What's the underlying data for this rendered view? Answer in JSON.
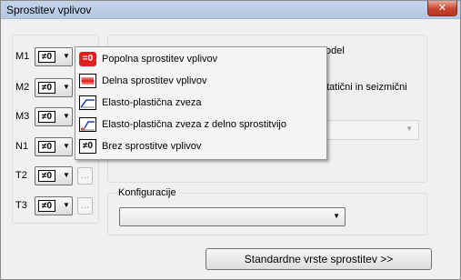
{
  "window": {
    "title": "Sprostitev vplivov",
    "close_label": "✕"
  },
  "rows": [
    {
      "label": "M1",
      "value": "≠0"
    },
    {
      "label": "M2",
      "value": "≠0"
    },
    {
      "label": "M3",
      "value": "≠0"
    },
    {
      "label": "N1",
      "value": "≠0"
    },
    {
      "label": "T2",
      "value": "≠0",
      "dots": "..."
    },
    {
      "label": "T3",
      "value": "≠0",
      "dots": "..."
    }
  ],
  "background": {
    "text_model": "odel",
    "text_static": "tatični in seizmični"
  },
  "configuration": {
    "label": "Konfiguracije",
    "selected": ""
  },
  "std_button_label": "Standardne vrste sprostitev >>",
  "menu": {
    "items": [
      {
        "label": "Popolna sprostitev vplivov",
        "icon": "eq0-icon",
        "icon_text": "=0"
      },
      {
        "label": "Delna sprostitev vplivov",
        "icon": "spring-icon"
      },
      {
        "label": "Elasto-plastična zveza",
        "icon": "elasto-plastic-icon"
      },
      {
        "label": "Elasto-plastična zveza z delno sprostitvijo",
        "icon": "elasto-plastic-partial-icon"
      },
      {
        "label": "Brez sprostitve vplivov",
        "icon": "ne0-icon",
        "icon_text": "≠0"
      }
    ]
  },
  "colors": {
    "title_bar": "#c4d3e8",
    "close_button": "#c7432c",
    "eq0_icon": "#e31f1f",
    "curve_blue": "#1f3fbf"
  }
}
